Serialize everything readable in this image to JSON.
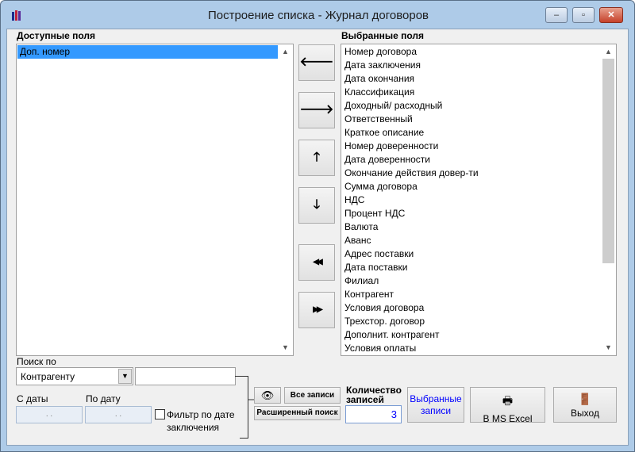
{
  "window": {
    "title": "Построение списка - Журнал договоров",
    "minimize": "–",
    "maximize": "▫",
    "close": "✕"
  },
  "available": {
    "label": "Доступные поля",
    "items": [
      "Доп. номер"
    ]
  },
  "selected": {
    "label": "Выбранные поля",
    "items": [
      "Номер договора",
      "Дата заключения",
      "Дата окончания",
      "Классификация",
      "Доходный/ расходный",
      "Ответственный",
      "Краткое описание",
      "Номер доверенности",
      "Дата доверенности",
      "Окончание действия довер-ти",
      "Сумма договора",
      "НДС",
      "Процент НДС",
      "Валюта",
      "Аванс",
      "Адрес поставки",
      "Дата поставки",
      "Филиал",
      "Контрагент",
      "Условия договора",
      "Трехстор. договор",
      "Дополнит. контрагент",
      "Условия оплаты"
    ]
  },
  "move_buttons": {
    "left": "🡐",
    "right": "🡒",
    "up": "🡑",
    "down": "🡓",
    "all_left": "◀◀",
    "all_right": "▶▶"
  },
  "search": {
    "label": "Поиск по",
    "by": "Контрагенту",
    "value": "",
    "from_label": "С даты",
    "from_value": ". .",
    "to_label": "По дату",
    "to_value": ". .",
    "filter_label": "Фильтр по дате заключения",
    "filter_checked": false
  },
  "buttons": {
    "all_records": "Все записи",
    "advanced": "Расширенный поиск",
    "selected_records": "Выбранные записи",
    "excel": "В MS Excel",
    "exit": "Выход"
  },
  "count": {
    "label": "Количество записей",
    "value": "3"
  },
  "colors": {
    "selection": "#3399ff",
    "accent_text": "#0000ff"
  }
}
